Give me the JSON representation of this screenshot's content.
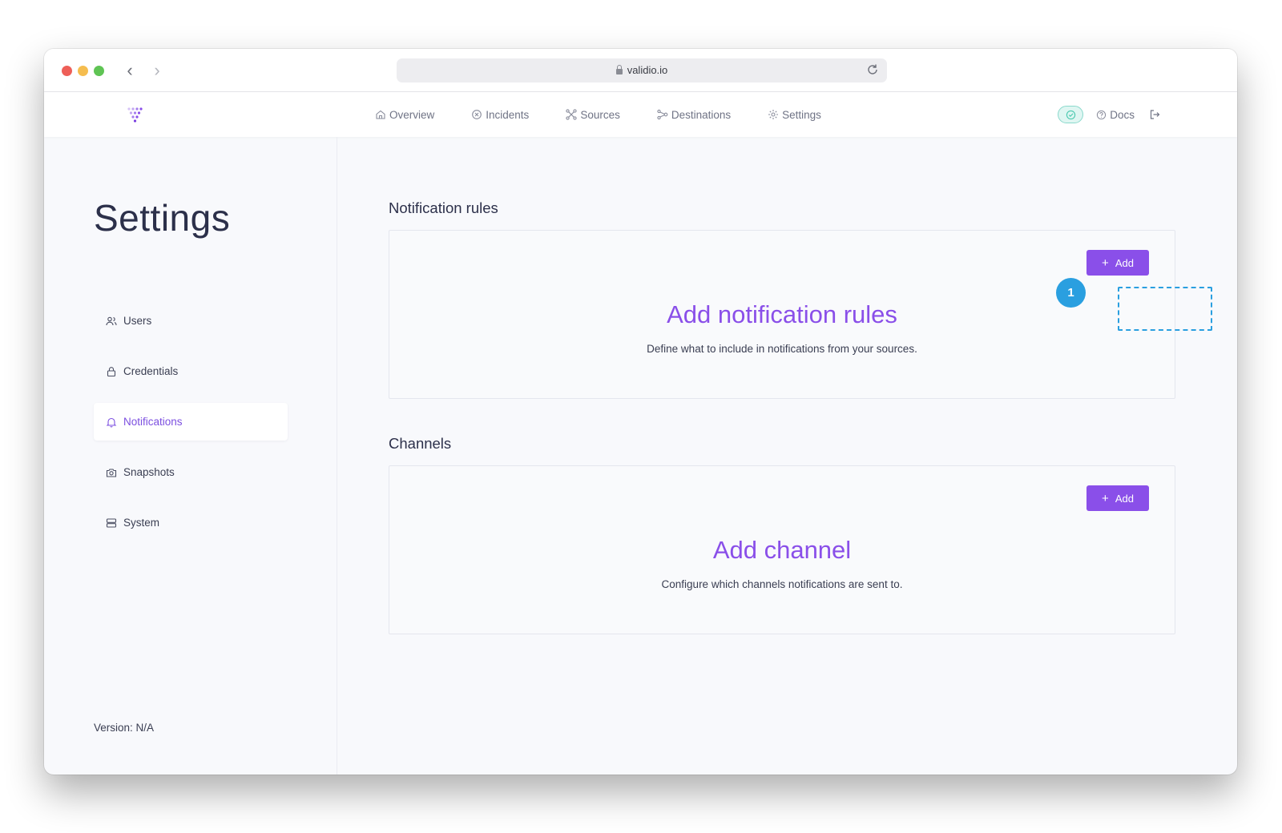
{
  "browser": {
    "url": "validio.io"
  },
  "nav": {
    "items": [
      {
        "label": "Overview",
        "icon": "home-icon"
      },
      {
        "label": "Incidents",
        "icon": "x-circle-icon"
      },
      {
        "label": "Sources",
        "icon": "nodes-icon"
      },
      {
        "label": "Destinations",
        "icon": "share-icon"
      },
      {
        "label": "Settings",
        "icon": "gear-icon"
      }
    ],
    "docs_label": "Docs",
    "status_icon": "check-circle-icon"
  },
  "sidebar": {
    "title": "Settings",
    "items": [
      {
        "label": "Users",
        "icon": "users-icon",
        "active": false
      },
      {
        "label": "Credentials",
        "icon": "lock-icon",
        "active": false
      },
      {
        "label": "Notifications",
        "icon": "bell-icon",
        "active": true
      },
      {
        "label": "Snapshots",
        "icon": "camera-icon",
        "active": false
      },
      {
        "label": "System",
        "icon": "server-icon",
        "active": false
      }
    ],
    "version": "Version: N/A"
  },
  "sections": {
    "rules": {
      "heading": "Notification rules",
      "add_label": "Add",
      "title": "Add notification rules",
      "description": "Define what to include in notifications from your sources."
    },
    "channels": {
      "heading": "Channels",
      "add_label": "Add",
      "title": "Add channel",
      "description": "Configure which channels notifications are sent to."
    }
  },
  "callout": {
    "number": "1"
  },
  "colors": {
    "accent": "#8a4fe9",
    "callout": "#2a9fe0",
    "status": "#4cc9b0"
  }
}
